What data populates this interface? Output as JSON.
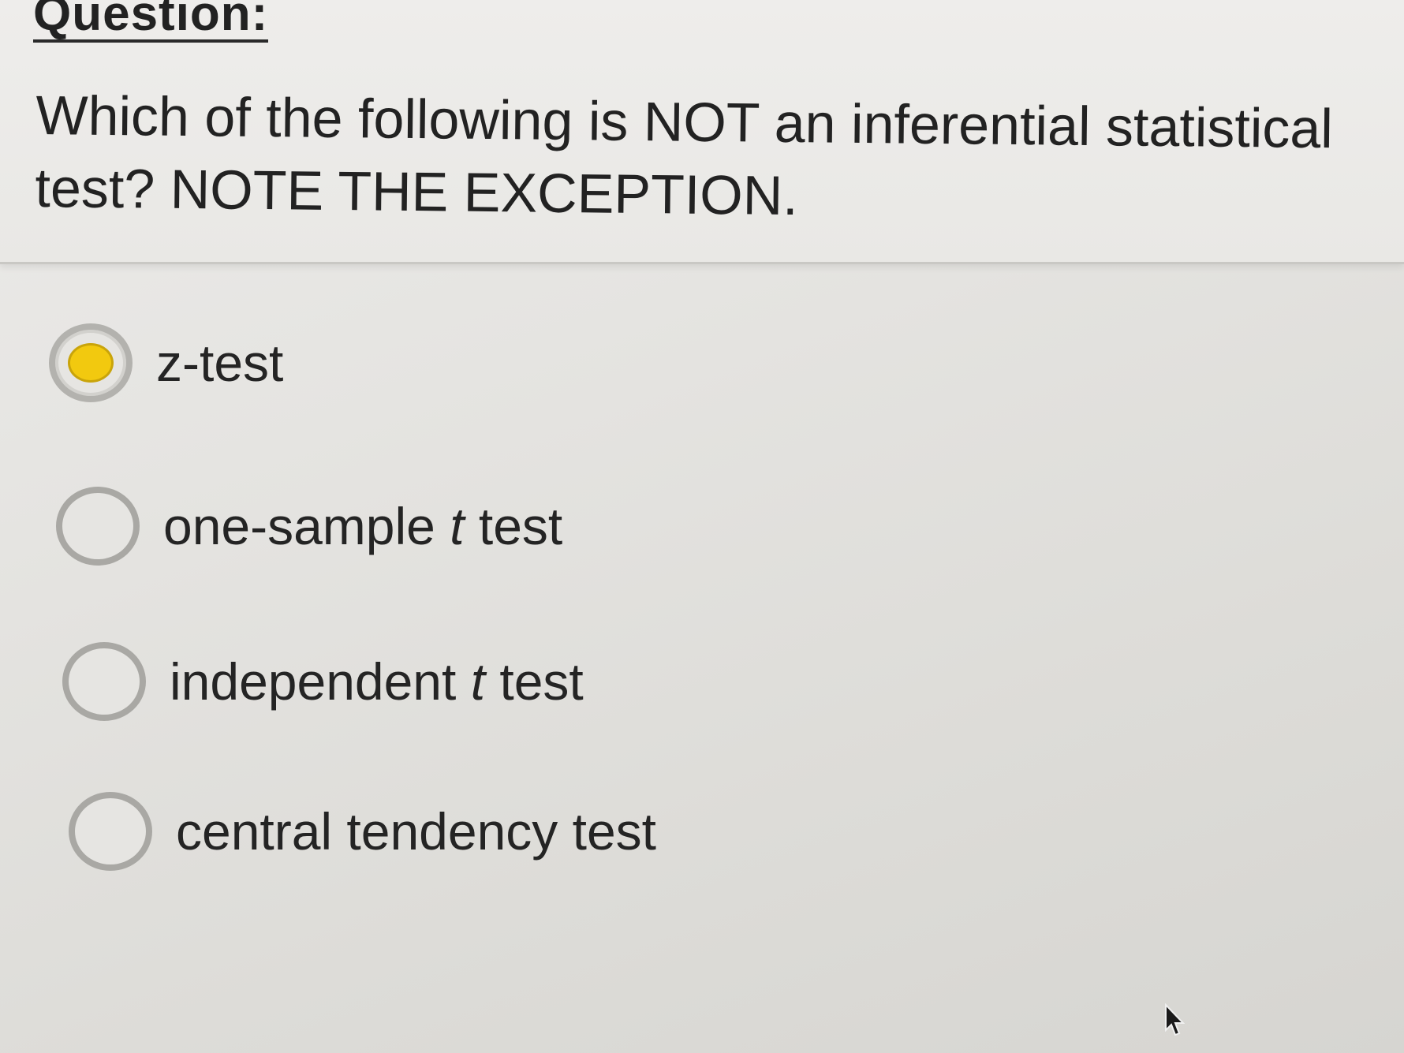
{
  "question": {
    "label": "Question:",
    "text": "Which of the following is NOT an inferential statistical test? NOTE THE EXCEPTION."
  },
  "options": [
    {
      "label": "z-test",
      "selected": true
    },
    {
      "label_pre": "one-sample ",
      "label_ital": "t",
      "label_post": " test",
      "selected": false
    },
    {
      "label_pre": "independent ",
      "label_ital": "t",
      "label_post": " test",
      "selected": false
    },
    {
      "label": "central tendency test",
      "selected": false
    }
  ],
  "colors": {
    "selected_dot": "#f2c90f",
    "radio_border": "#a9a8a4"
  },
  "icons": {
    "cursor": "mouse-pointer-icon"
  }
}
